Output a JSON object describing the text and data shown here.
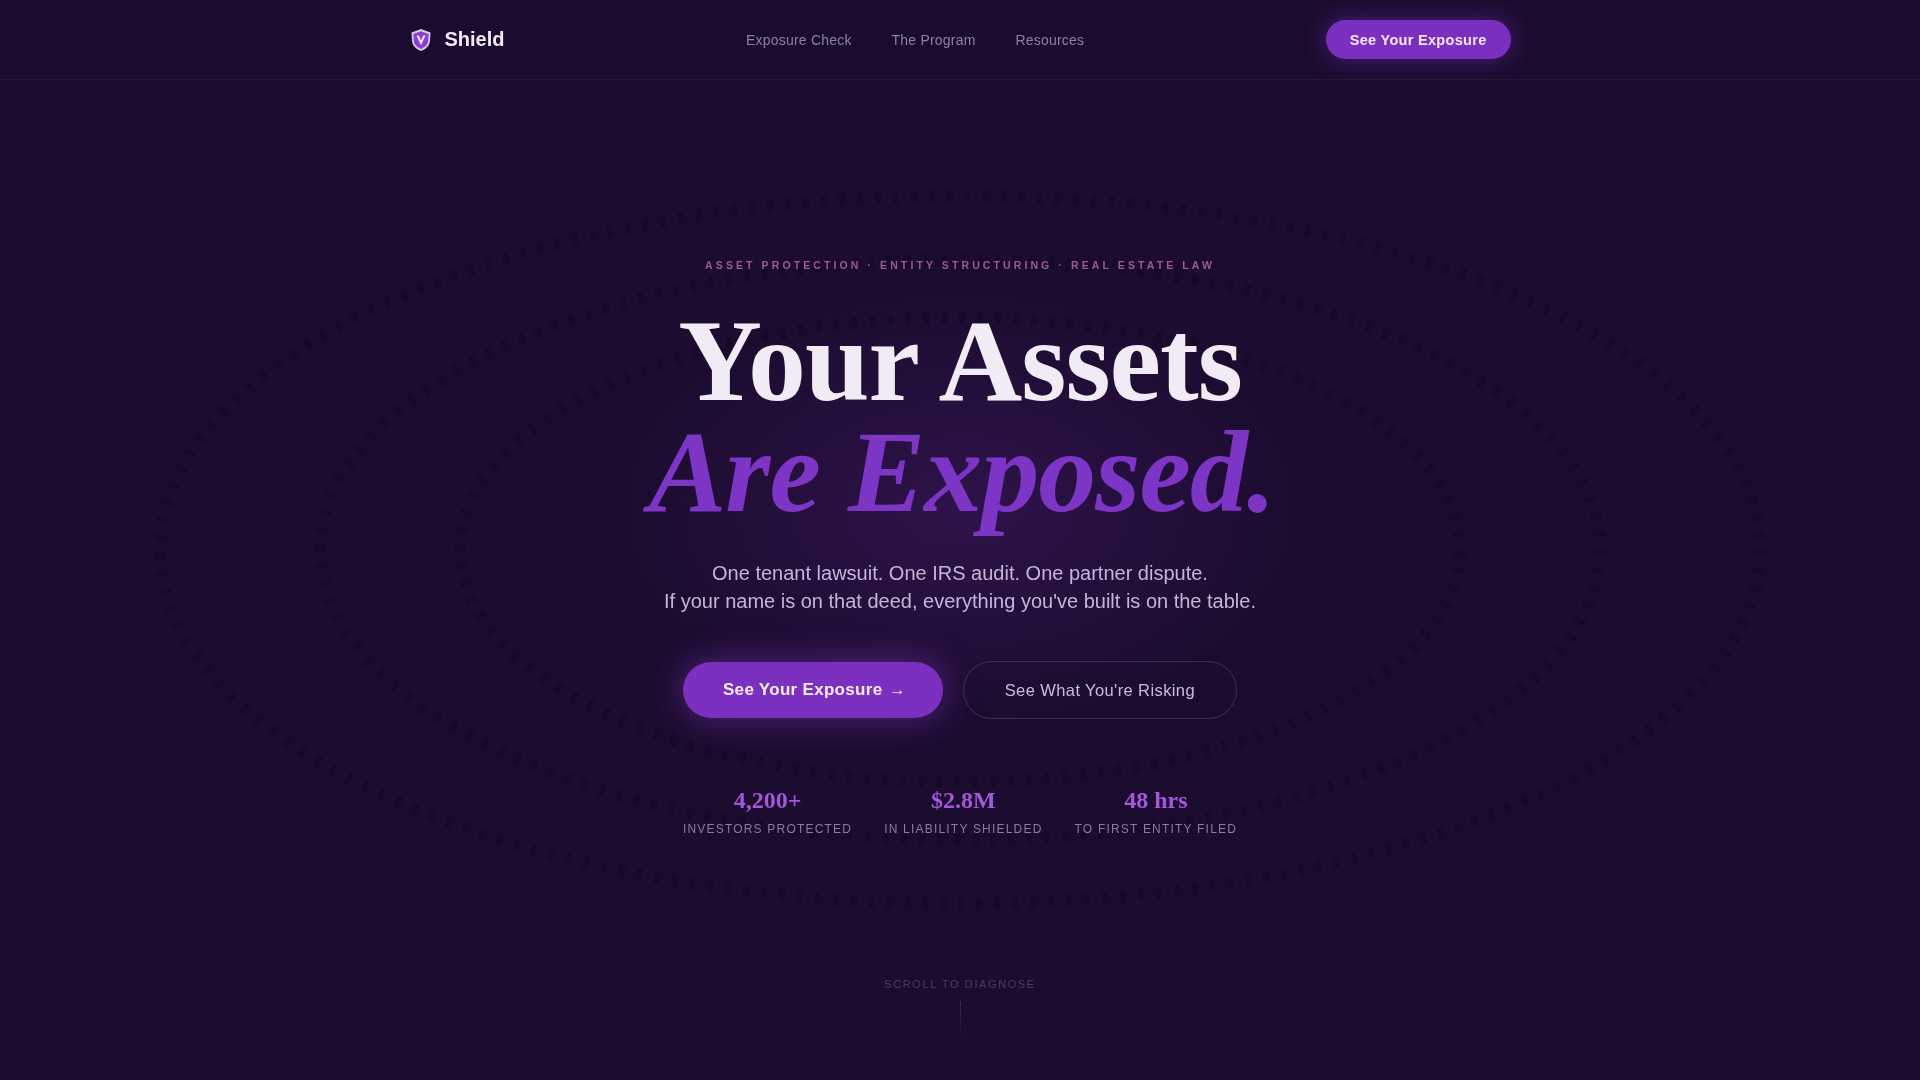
{
  "nav": {
    "brand": "Shield",
    "links": [
      {
        "label": "Exposure Check"
      },
      {
        "label": "The Program"
      },
      {
        "label": "Resources"
      }
    ],
    "cta": "See Your Exposure"
  },
  "hero": {
    "eyebrow": "ASSET PROTECTION · ENTITY STRUCTURING · REAL ESTATE LAW",
    "headline": {
      "line_1": "Your Assets",
      "line_2": "Are Exposed."
    },
    "subtitle": [
      "One tenant lawsuit. One IRS audit. One partner dispute.",
      "If your name is on that deed, everything you've built is on the table."
    ],
    "buttons": [
      {
        "kind": "primary",
        "label": "See Your Exposure",
        "arrow": "→"
      },
      {
        "kind": "secondary",
        "label": "See What You're Risking"
      }
    ],
    "stats": [
      {
        "value": "4,200+",
        "label": "INVESTORS PROTECTED"
      },
      {
        "value": "$2.8M",
        "label": "IN LIABILITY SHIELDED"
      },
      {
        "value": "48 hrs",
        "label": "TO FIRST ENTITY FILED"
      }
    ],
    "scroll_hint": "SCROLL TO DIAGNOSE"
  }
}
